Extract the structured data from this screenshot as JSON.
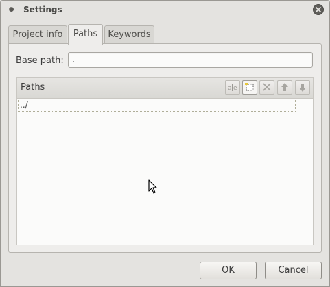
{
  "window": {
    "title": "Settings"
  },
  "tabs": [
    {
      "label": "Project info"
    },
    {
      "label": "Paths"
    },
    {
      "label": "Keywords"
    }
  ],
  "base_path": {
    "label": "Base path:",
    "value": "."
  },
  "paths": {
    "title": "Paths",
    "items": [
      "../"
    ],
    "toolbar": [
      "rename-icon",
      "new-icon",
      "delete-icon",
      "move-up-icon",
      "move-down-icon"
    ]
  },
  "buttons": {
    "ok": "OK",
    "cancel": "Cancel"
  }
}
